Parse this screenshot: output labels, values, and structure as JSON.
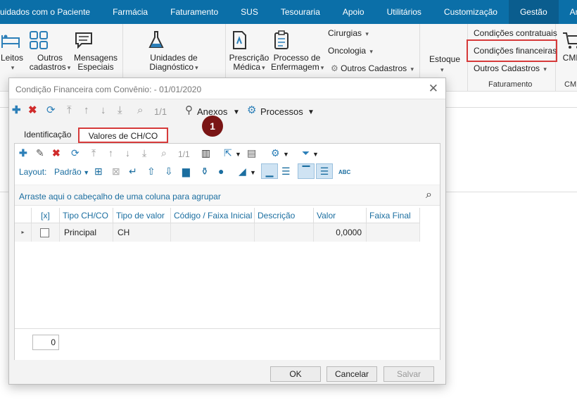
{
  "menu": [
    "uidados com o Paciente",
    "Farmácia",
    "Faturamento",
    "SUS",
    "Tesouraria",
    "Apoio",
    "Utilitários",
    "Customização",
    "Gestão",
    "Ambiente"
  ],
  "ribbon": {
    "leitos": "Leitos",
    "outros_cadastros": [
      "Outros",
      "cadastros"
    ],
    "mensagens": [
      "Mensagens",
      "Especiais"
    ],
    "unidades": [
      "Unidades de",
      "Diagnóstico"
    ],
    "prescricao": [
      "Prescrição",
      "Médica"
    ],
    "processo": [
      "Processo de",
      "Enfermagem"
    ],
    "cirurgias": "Cirurgias",
    "oncologia": "Oncologia",
    "outros_cadastros2": "Outros Cadastros",
    "estoque": "Estoque",
    "cond_contratuais": "Condições contratuais",
    "cond_financeiras": "Condições financeiras",
    "outros_cadastros3": "Outros Cadastros",
    "faturamento": "Faturamento",
    "cme": "CME",
    "cme2": "CME"
  },
  "dialog": {
    "title": "Condição Financeira com Convênio:  - 01/01/2020",
    "pager": "1/1",
    "anexos": "Anexos",
    "processos": "Processos",
    "tabs": [
      "Identificação",
      "Valores de CH/CO"
    ],
    "grid_pager": "1/1",
    "layout_label": "Layout:",
    "layout_value": "Padrão",
    "group_hint": "Arraste aqui o cabeçalho de uma coluna para agrupar",
    "columns": [
      "[x]",
      "Tipo CH/CO",
      "Tipo de valor",
      "Código / Faixa Inicial",
      "Descrição",
      "Valor",
      "Faixa Final"
    ],
    "rows": [
      [
        "",
        "Principal",
        "CH",
        "",
        "",
        "0,0000",
        ""
      ]
    ],
    "count": "0",
    "ok": "OK",
    "cancelar": "Cancelar",
    "salvar": "Salvar"
  },
  "badge": "1",
  "colors": {
    "menu_bar": "#0b6fa8",
    "highlight": "#d63a3a",
    "badge": "#7a1515",
    "accent_blue": "#1b6ea0"
  }
}
